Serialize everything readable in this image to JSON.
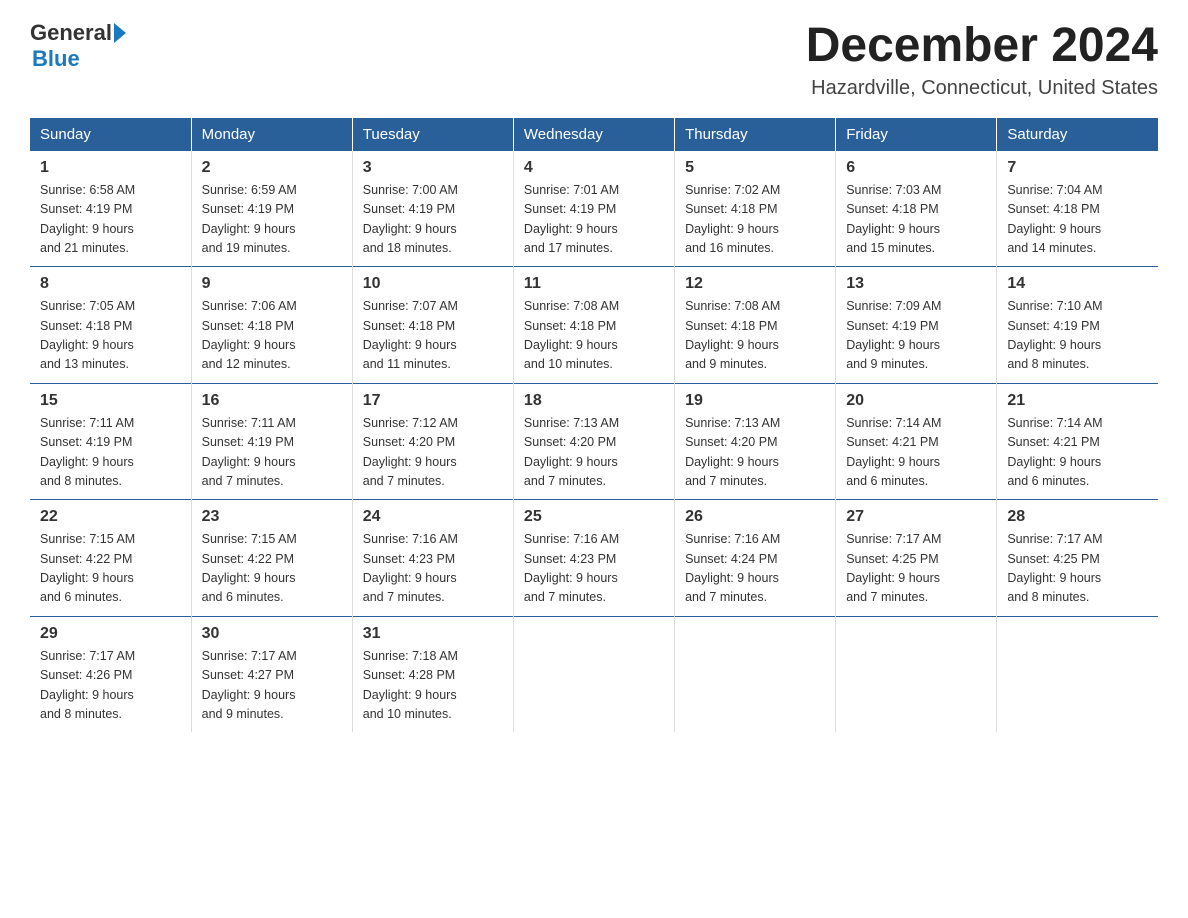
{
  "logo": {
    "general": "General",
    "blue": "Blue"
  },
  "header": {
    "month_year": "December 2024",
    "location": "Hazardville, Connecticut, United States"
  },
  "days_of_week": [
    "Sunday",
    "Monday",
    "Tuesday",
    "Wednesday",
    "Thursday",
    "Friday",
    "Saturday"
  ],
  "weeks": [
    [
      {
        "day": "1",
        "sunrise": "6:58 AM",
        "sunset": "4:19 PM",
        "daylight": "9 hours and 21 minutes."
      },
      {
        "day": "2",
        "sunrise": "6:59 AM",
        "sunset": "4:19 PM",
        "daylight": "9 hours and 19 minutes."
      },
      {
        "day": "3",
        "sunrise": "7:00 AM",
        "sunset": "4:19 PM",
        "daylight": "9 hours and 18 minutes."
      },
      {
        "day": "4",
        "sunrise": "7:01 AM",
        "sunset": "4:19 PM",
        "daylight": "9 hours and 17 minutes."
      },
      {
        "day": "5",
        "sunrise": "7:02 AM",
        "sunset": "4:18 PM",
        "daylight": "9 hours and 16 minutes."
      },
      {
        "day": "6",
        "sunrise": "7:03 AM",
        "sunset": "4:18 PM",
        "daylight": "9 hours and 15 minutes."
      },
      {
        "day": "7",
        "sunrise": "7:04 AM",
        "sunset": "4:18 PM",
        "daylight": "9 hours and 14 minutes."
      }
    ],
    [
      {
        "day": "8",
        "sunrise": "7:05 AM",
        "sunset": "4:18 PM",
        "daylight": "9 hours and 13 minutes."
      },
      {
        "day": "9",
        "sunrise": "7:06 AM",
        "sunset": "4:18 PM",
        "daylight": "9 hours and 12 minutes."
      },
      {
        "day": "10",
        "sunrise": "7:07 AM",
        "sunset": "4:18 PM",
        "daylight": "9 hours and 11 minutes."
      },
      {
        "day": "11",
        "sunrise": "7:08 AM",
        "sunset": "4:18 PM",
        "daylight": "9 hours and 10 minutes."
      },
      {
        "day": "12",
        "sunrise": "7:08 AM",
        "sunset": "4:18 PM",
        "daylight": "9 hours and 9 minutes."
      },
      {
        "day": "13",
        "sunrise": "7:09 AM",
        "sunset": "4:19 PM",
        "daylight": "9 hours and 9 minutes."
      },
      {
        "day": "14",
        "sunrise": "7:10 AM",
        "sunset": "4:19 PM",
        "daylight": "9 hours and 8 minutes."
      }
    ],
    [
      {
        "day": "15",
        "sunrise": "7:11 AM",
        "sunset": "4:19 PM",
        "daylight": "9 hours and 8 minutes."
      },
      {
        "day": "16",
        "sunrise": "7:11 AM",
        "sunset": "4:19 PM",
        "daylight": "9 hours and 7 minutes."
      },
      {
        "day": "17",
        "sunrise": "7:12 AM",
        "sunset": "4:20 PM",
        "daylight": "9 hours and 7 minutes."
      },
      {
        "day": "18",
        "sunrise": "7:13 AM",
        "sunset": "4:20 PM",
        "daylight": "9 hours and 7 minutes."
      },
      {
        "day": "19",
        "sunrise": "7:13 AM",
        "sunset": "4:20 PM",
        "daylight": "9 hours and 7 minutes."
      },
      {
        "day": "20",
        "sunrise": "7:14 AM",
        "sunset": "4:21 PM",
        "daylight": "9 hours and 6 minutes."
      },
      {
        "day": "21",
        "sunrise": "7:14 AM",
        "sunset": "4:21 PM",
        "daylight": "9 hours and 6 minutes."
      }
    ],
    [
      {
        "day": "22",
        "sunrise": "7:15 AM",
        "sunset": "4:22 PM",
        "daylight": "9 hours and 6 minutes."
      },
      {
        "day": "23",
        "sunrise": "7:15 AM",
        "sunset": "4:22 PM",
        "daylight": "9 hours and 6 minutes."
      },
      {
        "day": "24",
        "sunrise": "7:16 AM",
        "sunset": "4:23 PM",
        "daylight": "9 hours and 7 minutes."
      },
      {
        "day": "25",
        "sunrise": "7:16 AM",
        "sunset": "4:23 PM",
        "daylight": "9 hours and 7 minutes."
      },
      {
        "day": "26",
        "sunrise": "7:16 AM",
        "sunset": "4:24 PM",
        "daylight": "9 hours and 7 minutes."
      },
      {
        "day": "27",
        "sunrise": "7:17 AM",
        "sunset": "4:25 PM",
        "daylight": "9 hours and 7 minutes."
      },
      {
        "day": "28",
        "sunrise": "7:17 AM",
        "sunset": "4:25 PM",
        "daylight": "9 hours and 8 minutes."
      }
    ],
    [
      {
        "day": "29",
        "sunrise": "7:17 AM",
        "sunset": "4:26 PM",
        "daylight": "9 hours and 8 minutes."
      },
      {
        "day": "30",
        "sunrise": "7:17 AM",
        "sunset": "4:27 PM",
        "daylight": "9 hours and 9 minutes."
      },
      {
        "day": "31",
        "sunrise": "7:18 AM",
        "sunset": "4:28 PM",
        "daylight": "9 hours and 10 minutes."
      },
      null,
      null,
      null,
      null
    ]
  ],
  "labels": {
    "sunrise": "Sunrise: ",
    "sunset": "Sunset: ",
    "daylight": "Daylight: "
  }
}
